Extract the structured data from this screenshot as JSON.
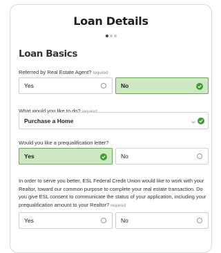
{
  "form": {
    "title": "Loan Details",
    "section_title": "Loan Basics",
    "required_text": "required",
    "q_agent": {
      "label": "Referred by Real Estate Agent?",
      "options": [
        "Yes",
        "No"
      ],
      "selected": "No"
    },
    "q_purpose": {
      "label": "What would you like to do?",
      "value": "Purchase a Home"
    },
    "q_prequal": {
      "label": "Would you like a prequalification letter?",
      "options": [
        "Yes",
        "No"
      ],
      "selected": "Yes"
    },
    "q_consent": {
      "label": "In order to serve you better, ESL Federal Credit Union would like to work with your Realtor, toward our common purpose to complete your real estate transaction. Do you give ESL consent to communicate the status of your application, including your prequalification amount to your Realtor?",
      "options": [
        "Yes",
        "No"
      ],
      "selected": null
    }
  },
  "progress": {
    "total_steps": 3,
    "current_step": 1
  },
  "colors": {
    "selected_bg": "#cde8c2",
    "selected_border": "#5fb24a",
    "check": "#3f9d37"
  },
  "icons": {
    "selected": "check-circle-icon",
    "unselected": "radio-circle-icon",
    "dropdown": "chevron-down-icon"
  }
}
